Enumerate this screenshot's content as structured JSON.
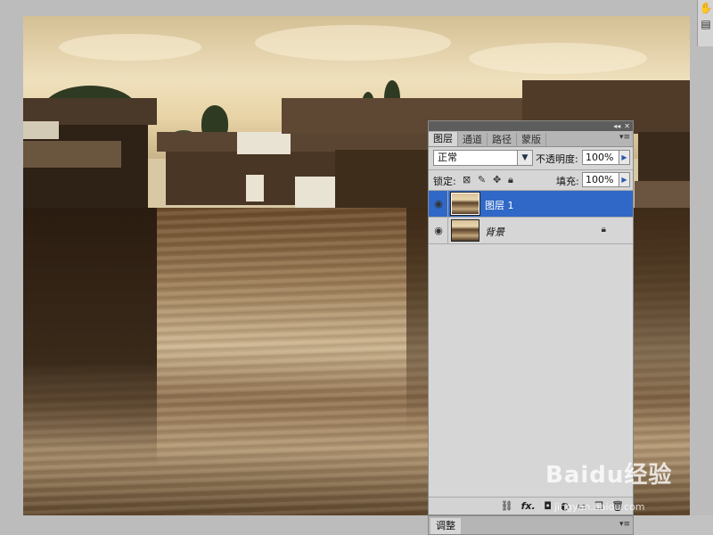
{
  "layers_panel": {
    "tabs": [
      {
        "label": "图层",
        "active": true
      },
      {
        "label": "通道",
        "active": false
      },
      {
        "label": "路径",
        "active": false
      },
      {
        "label": "蒙版",
        "active": false
      }
    ],
    "blend_mode": "正常",
    "opacity_label": "不透明度:",
    "opacity_value": "100%",
    "lock_label": "锁定:",
    "fill_label": "填充:",
    "fill_value": "100%",
    "layers": [
      {
        "name": "图层 1",
        "selected": true,
        "visible": true,
        "locked": false
      },
      {
        "name": "背景",
        "selected": false,
        "visible": true,
        "locked": true
      }
    ],
    "bottom_icons": [
      "link-icon",
      "fx-icon",
      "mask-icon",
      "adjustment-icon",
      "folder-icon",
      "new-layer-icon",
      "trash-icon"
    ],
    "fx_label": "fx."
  },
  "adjust_panel": {
    "tab_label": "调整"
  },
  "watermark": {
    "brand": "Baidu经验",
    "url": "jingyan.baidu.com"
  },
  "colors": {
    "selection": "#2f68c6",
    "panel_bg": "#d6d6d6",
    "app_bg": "#bcbcbc"
  }
}
